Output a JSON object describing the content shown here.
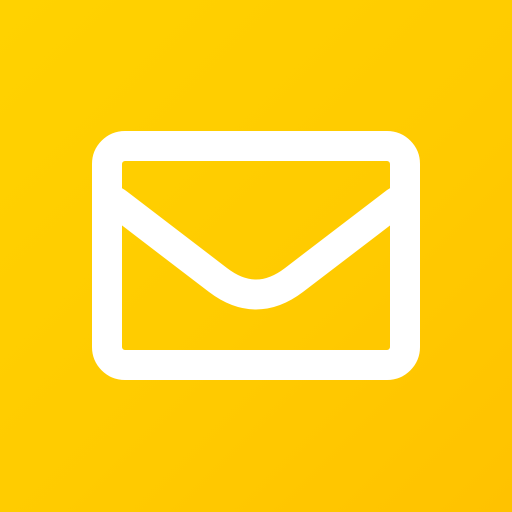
{
  "app": {
    "icon": "mail-icon",
    "background_color": "#FFCF00",
    "glyph_color": "#FFFFFF"
  }
}
